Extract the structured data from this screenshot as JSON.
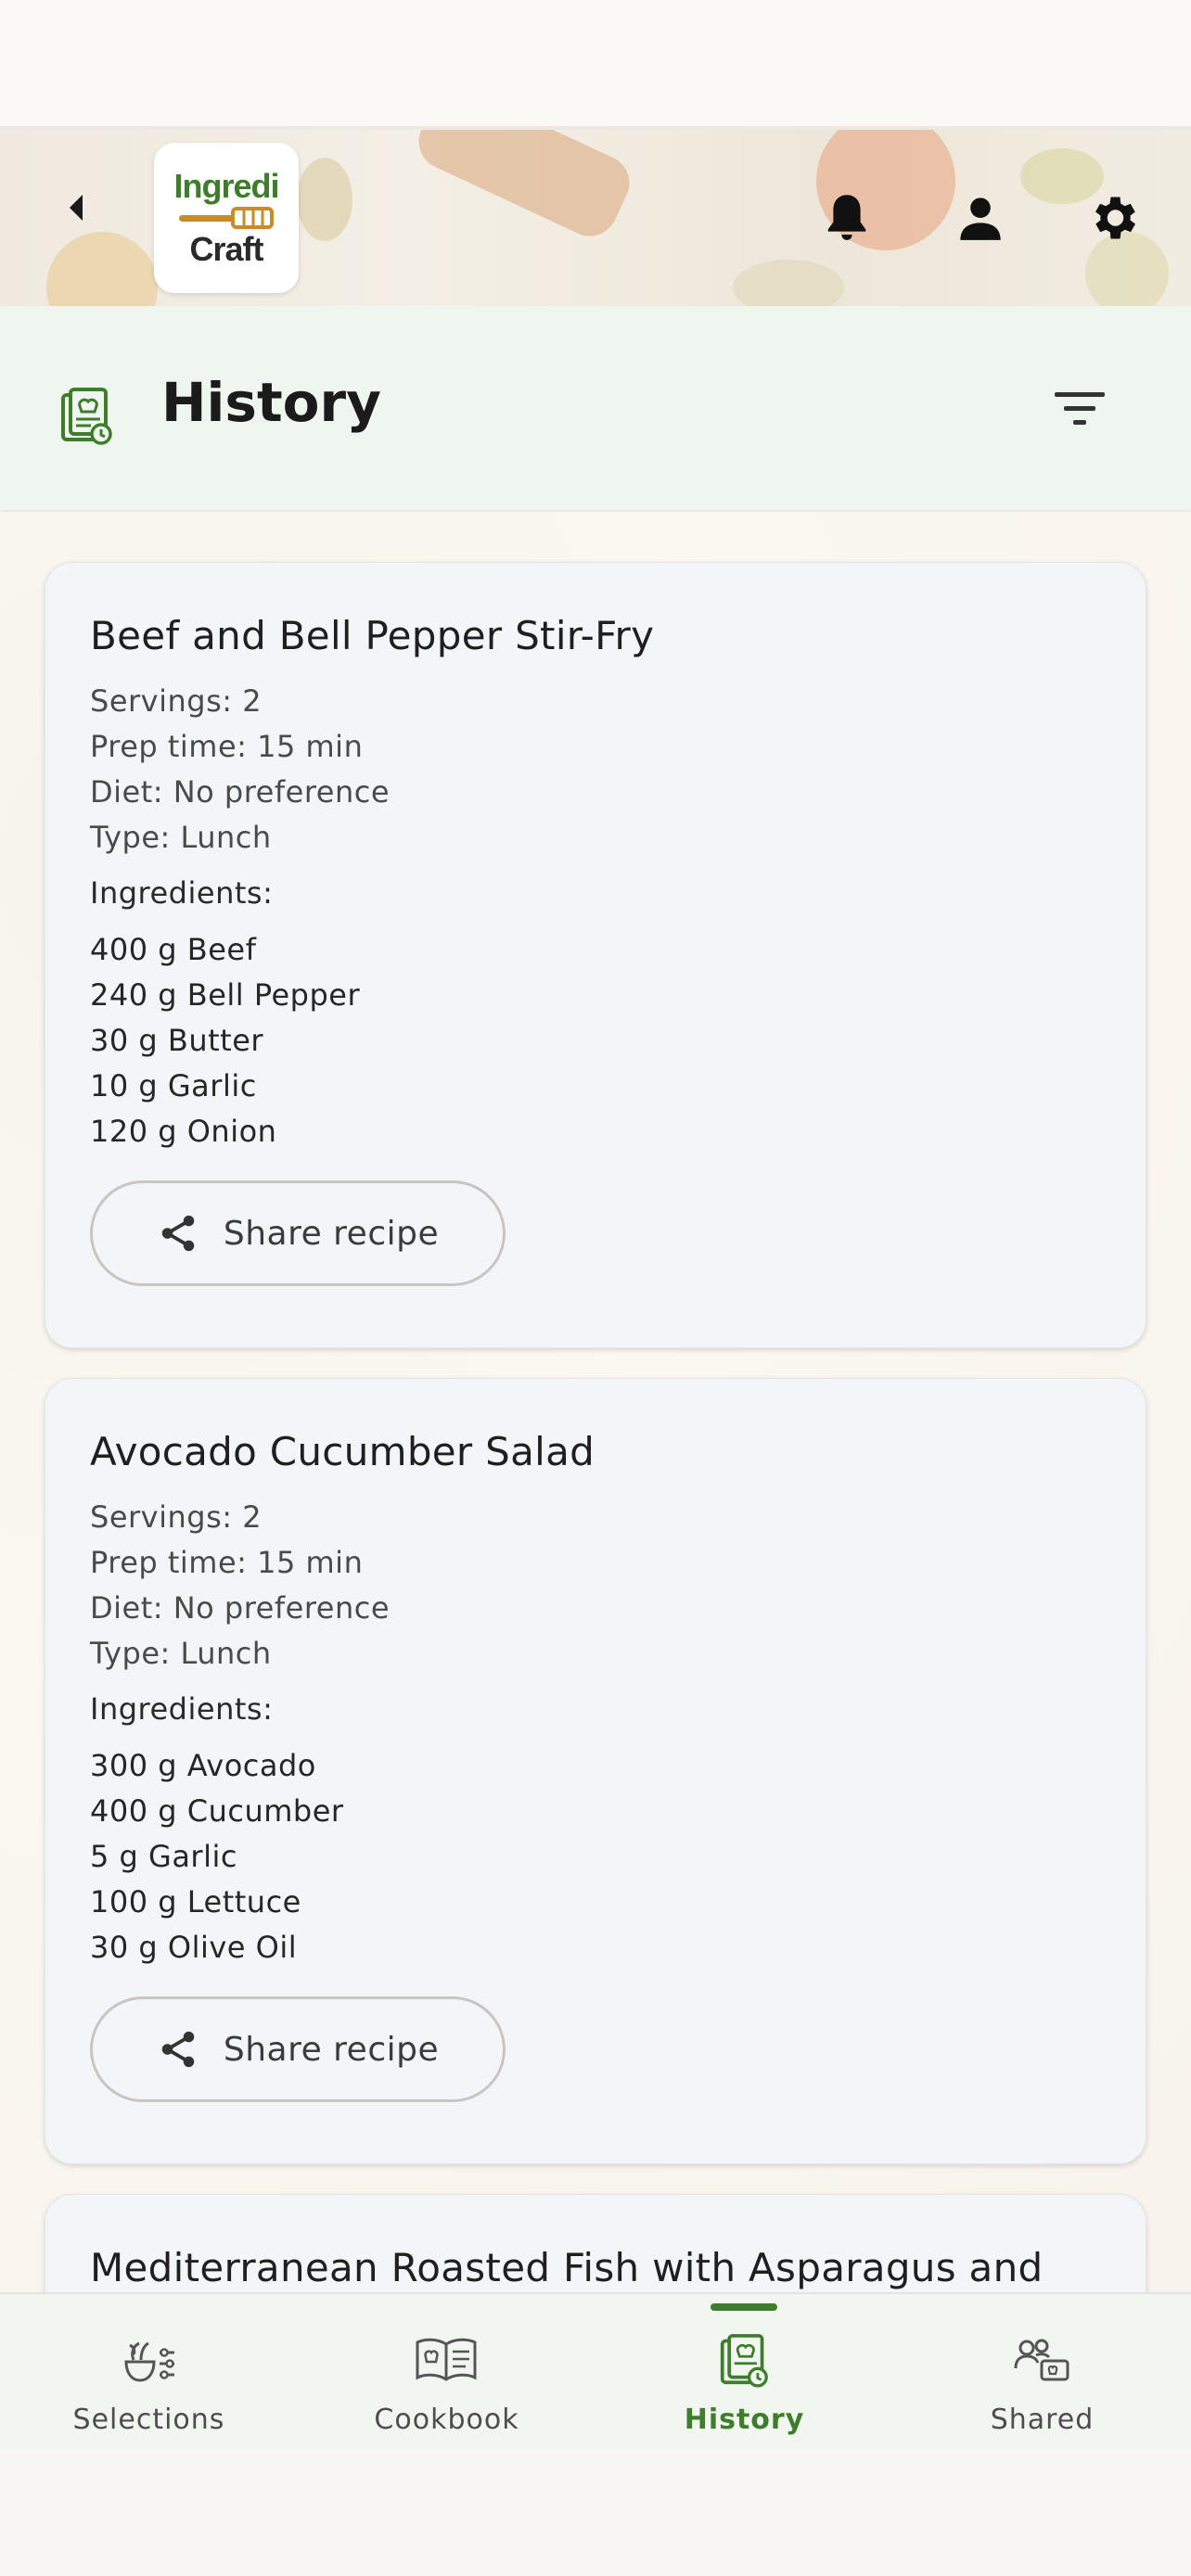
{
  "app": {
    "logo_line1": "Ingredi",
    "logo_line2": "Craft"
  },
  "header": {
    "back_icon": "chevron-left-icon",
    "notification_icon": "bell-icon",
    "profile_icon": "person-icon",
    "settings_icon": "gear-icon"
  },
  "title_bar": {
    "title": "History",
    "icon": "history-recipe-icon",
    "filter_icon": "filter-icon"
  },
  "recipes": [
    {
      "title": "Beef and Bell Pepper Stir-Fry",
      "servings": "Servings: 2",
      "prep_time": "Prep time: 15 min",
      "diet": "Diet: No preference",
      "type": "Type: Lunch",
      "ingredients_label": "Ingredients:",
      "ingredients": [
        "400 g Beef",
        "240 g Bell Pepper",
        "30 g Butter",
        "10 g Garlic",
        "120 g Onion"
      ],
      "share_label": "Share recipe"
    },
    {
      "title": "Avocado Cucumber Salad",
      "servings": "Servings: 2",
      "prep_time": "Prep time: 15 min",
      "diet": "Diet: No preference",
      "type": "Type: Lunch",
      "ingredients_label": "Ingredients:",
      "ingredients": [
        "300 g Avocado",
        "400 g Cucumber",
        "5 g Garlic",
        "100 g Lettuce",
        "30 g Olive Oil"
      ],
      "share_label": "Share recipe"
    },
    {
      "title": "Mediterranean Roasted Fish with Asparagus and"
    }
  ],
  "bottom_nav": {
    "items": [
      {
        "label": "Selections",
        "icon": "selections-icon"
      },
      {
        "label": "Cookbook",
        "icon": "cookbook-icon"
      },
      {
        "label": "History",
        "icon": "history-icon",
        "active": true
      },
      {
        "label": "Shared",
        "icon": "shared-icon"
      }
    ]
  },
  "colors": {
    "accent": "#3e7d2c",
    "title_bar_bg": "#eff6ef",
    "card_bg": "#f4f5f9"
  }
}
